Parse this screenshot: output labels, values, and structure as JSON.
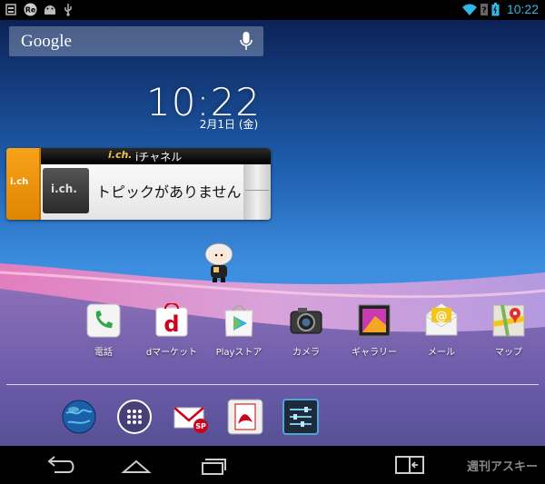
{
  "status_bar": {
    "time": "10:22",
    "left_icons": [
      "screen-icon",
      "re-app-icon",
      "android-icon",
      "usb-icon"
    ],
    "right_icons": [
      "wifi-icon",
      "battery-icon"
    ],
    "accent_color": "#33b5e5"
  },
  "search": {
    "logo_text": "Google",
    "mic_icon": "microphone-icon"
  },
  "clock_widget": {
    "time": "10:22",
    "date": "2月1日 (金)"
  },
  "ichannel_widget": {
    "side_logo": "i.ch",
    "header_logo": "i.ch.",
    "header_title": "iチャネル",
    "thumb_logo": "i.ch.",
    "message": "トピックがありません",
    "accent_color": "#f39800"
  },
  "apps": [
    {
      "label": "電話",
      "icon": "phone-icon"
    },
    {
      "label": "dマーケット",
      "icon": "dmarket-icon"
    },
    {
      "label": "Playストア",
      "icon": "play-store-icon"
    },
    {
      "label": "カメラ",
      "icon": "camera-icon"
    },
    {
      "label": "ギャラリー",
      "icon": "gallery-icon"
    },
    {
      "label": "メール",
      "icon": "mail-icon"
    },
    {
      "label": "マップ",
      "icon": "maps-icon"
    }
  ],
  "dock": [
    {
      "icon": "browser-globe-icon"
    },
    {
      "icon": "app-drawer-icon"
    },
    {
      "icon": "sp-mail-icon"
    },
    {
      "icon": "pdf-reader-icon"
    },
    {
      "icon": "settings-icon"
    }
  ],
  "nav_bar": {
    "buttons": [
      "back-icon",
      "home-icon",
      "recent-apps-icon",
      "multiwindow-icon"
    ],
    "watermark": "週刊アスキー"
  }
}
